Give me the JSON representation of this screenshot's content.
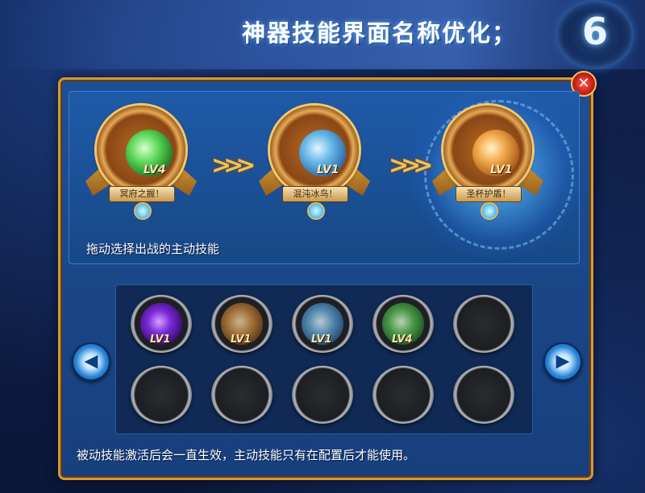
{
  "header": {
    "title": "神器技能界面名称优化；",
    "number": "6"
  },
  "close_label": "✕",
  "active_skills": [
    {
      "name": "冥府之握！",
      "level": "LV4",
      "gem_color": "green"
    },
    {
      "name": "混沌冰鸟！",
      "level": "LV1",
      "gem_color": "blue"
    },
    {
      "name": "圣杯护盾！",
      "level": "LV1",
      "gem_color": "orange"
    }
  ],
  "chevrons": ">>>",
  "hint_text": "拖动选择出战的主动技能",
  "skill_grid": {
    "prev_label": "◀",
    "next_label": "▶",
    "slots": [
      {
        "icon": "purple",
        "level": "LV1"
      },
      {
        "icon": "orange",
        "level": "LV1"
      },
      {
        "icon": "blue",
        "level": "LV1"
      },
      {
        "icon": "green",
        "level": "LV4"
      },
      {
        "icon": "empty",
        "level": ""
      },
      {
        "icon": "empty",
        "level": ""
      },
      {
        "icon": "empty",
        "level": ""
      },
      {
        "icon": "empty",
        "level": ""
      },
      {
        "icon": "empty",
        "level": ""
      },
      {
        "icon": "empty",
        "level": ""
      }
    ]
  },
  "footer_text": "被动技能激活后会一直生效，主动技能只有在配置后才能使用。"
}
